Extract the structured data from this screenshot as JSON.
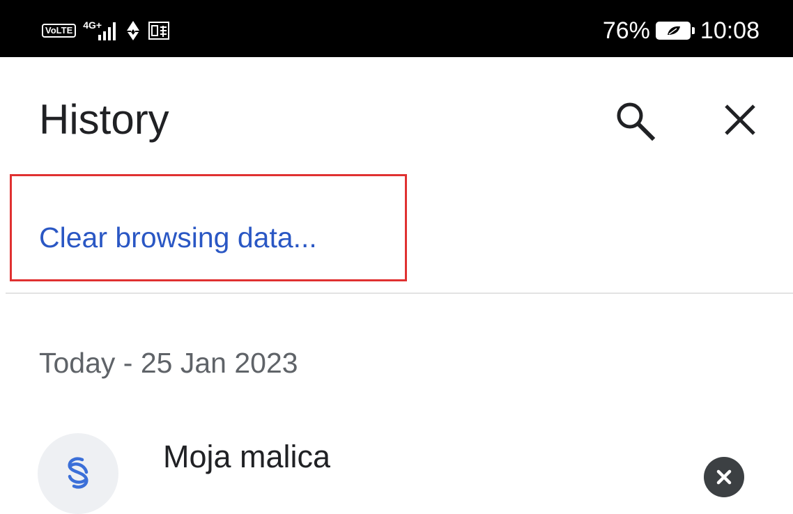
{
  "status_bar": {
    "volte": "VoLTE",
    "network": "4G+",
    "battery": "76%",
    "time": "10:08",
    "icons": [
      "volte-icon",
      "signal-icon",
      "data-arrows-icon",
      "app-notification-icon",
      "battery-saver-icon"
    ]
  },
  "header": {
    "title": "History",
    "actions": [
      "search-icon",
      "close-icon"
    ]
  },
  "clear_link": "Clear browsing data...",
  "date_header": "Today - 25 Jan 2023",
  "items": [
    {
      "title": "Moja malica",
      "icon": "site-favicon-icon",
      "remove_icon": "remove-icon"
    }
  ],
  "colors": {
    "link": "#2a57c4",
    "highlight_border": "#e03131",
    "status_bar_bg": "#000000",
    "text_primary": "#202124",
    "text_secondary": "#5f6368"
  }
}
